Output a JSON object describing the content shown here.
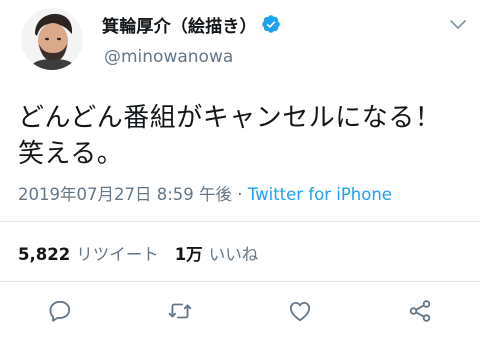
{
  "user": {
    "display_name": "箕輪厚介（絵描き）",
    "handle": "@minowanowa",
    "verified": true
  },
  "tweet": {
    "text_line1": "どんどん番組がキャンセルになる！",
    "text_line2": "笑える。",
    "timestamp": "2019年07月27日 8:59 午後",
    "separator": " · ",
    "source": "Twitter for iPhone"
  },
  "stats": {
    "retweets_count": "5,822",
    "retweets_label": "リツイート",
    "likes_count": "1万",
    "likes_label": "いいね"
  },
  "icons": {
    "verified": "verified-badge-icon",
    "caret": "chevron-down-icon",
    "reply": "reply-icon",
    "retweet": "retweet-icon",
    "like": "heart-icon",
    "share": "share-icon"
  },
  "colors": {
    "accent": "#1da1f2",
    "text": "#14171a",
    "secondary": "#657786",
    "divider": "#e1e8ed"
  }
}
